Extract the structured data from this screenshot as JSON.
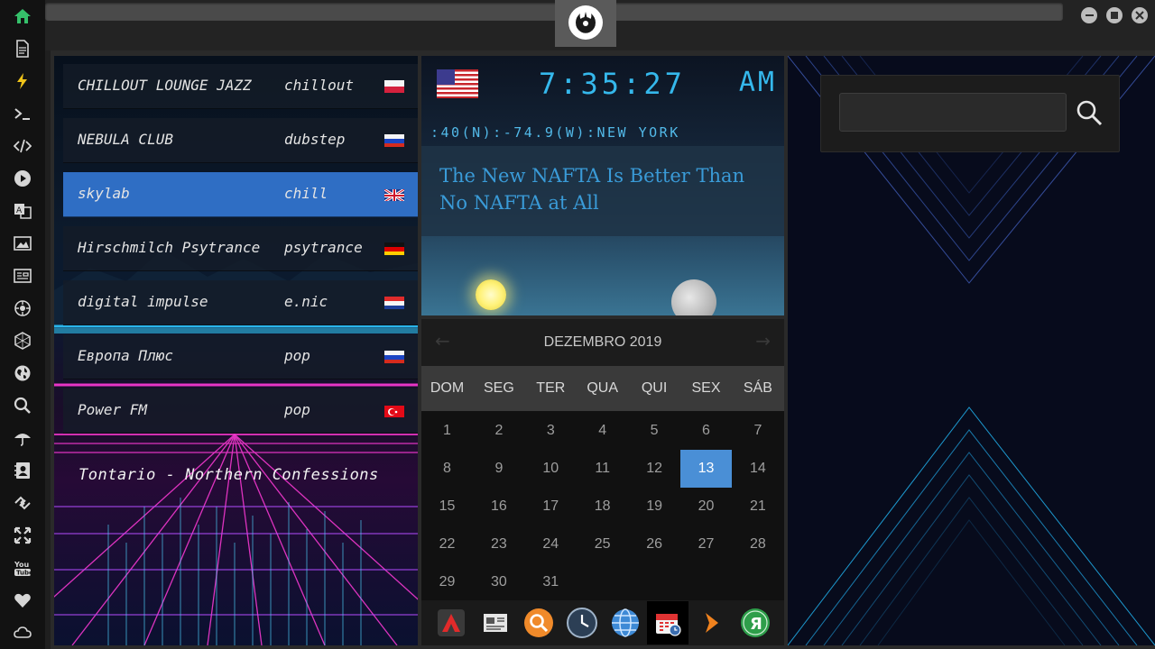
{
  "sidebar": {
    "icons": [
      "home-icon",
      "document-icon",
      "lightning-icon",
      "terminal-icon",
      "code-icon",
      "play-icon",
      "translate-icon",
      "image-icon",
      "news-icon",
      "settings-icon",
      "hexagon-icon",
      "globe-icon",
      "search-icon",
      "umbrella-icon",
      "contacts-icon",
      "link-icon",
      "expand-icon",
      "youtube-icon",
      "heart-icon",
      "cloud-icon"
    ]
  },
  "radio": {
    "stations": [
      {
        "name": "CHILLOUT LOUNGE JAZZ",
        "genre": "chillout",
        "flag": "poland"
      },
      {
        "name": "NEBULA CLUB",
        "genre": "dubstep",
        "flag": "russia"
      },
      {
        "name": "skylab",
        "genre": "chill",
        "flag": "uk"
      },
      {
        "name": "Hirschmilch Psytrance",
        "genre": "psytrance",
        "flag": "germany"
      },
      {
        "name": "digital impulse",
        "genre": "e.nic",
        "flag": "croatia"
      },
      {
        "name": "Европа Плюс",
        "genre": "pop",
        "flag": "russia"
      },
      {
        "name": "Power FM",
        "genre": "pop",
        "flag": "turkey"
      }
    ],
    "active_index": 2,
    "now_playing": "Tontario - Northern Confessions"
  },
  "clock": {
    "time": "7:35:27",
    "ampm": "AM",
    "location": ":40(N):-74.9(W):NEW YORK",
    "flag": "usa"
  },
  "news": {
    "headline": "The New NAFTA Is Better Than No NAFTA at All"
  },
  "calendar": {
    "month_label": "DEZEMBRO 2019",
    "prev": "←",
    "next": "→",
    "weekdays": [
      "DOM",
      "SEG",
      "TER",
      "QUA",
      "QUI",
      "SEX",
      "SÁB"
    ],
    "days": [
      1,
      2,
      3,
      4,
      5,
      6,
      7,
      8,
      9,
      10,
      11,
      12,
      13,
      14,
      15,
      16,
      17,
      18,
      19,
      20,
      21,
      22,
      23,
      24,
      25,
      26,
      27,
      28,
      29,
      30,
      31
    ],
    "first_weekday_index": 0,
    "today": 13
  },
  "dock_apps": [
    "app-launcher-icon",
    "news-reader-icon",
    "search-app-icon",
    "clock-app-icon",
    "browser-globe-icon",
    "calendar-app-icon",
    "media-forward-icon",
    "yandex-icon"
  ],
  "search": {
    "placeholder": "",
    "value": ""
  },
  "colors": {
    "clock_cyan": "#35b8ec",
    "active_station": "#2f6ec4",
    "today_highlight": "#4a8fd6",
    "headline_blue": "#3a9bd8"
  }
}
